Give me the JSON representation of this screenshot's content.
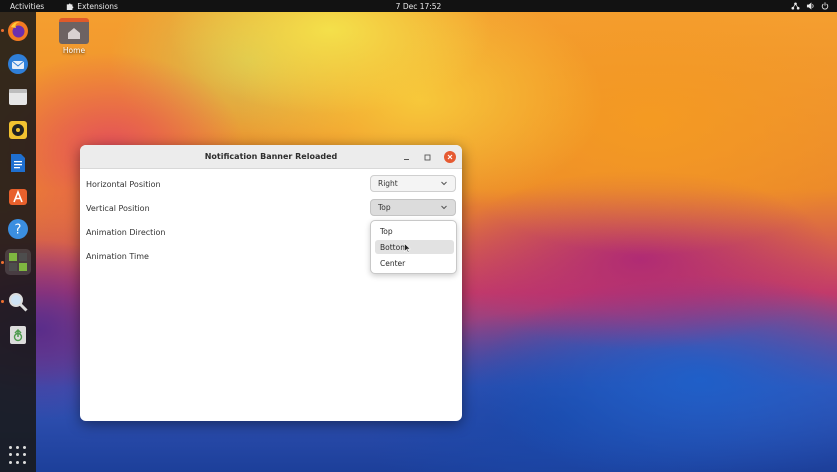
{
  "topbar": {
    "activities": "Activities",
    "extensions": "Extensions",
    "clock": "7 Dec  17:52"
  },
  "desktop": {
    "home_label": "Home"
  },
  "dock": {
    "items": [
      "firefox-icon",
      "thunderbird-icon",
      "files-icon",
      "rhythmbox-icon",
      "writer-icon",
      "software-icon",
      "help-icon",
      "extensions-icon",
      "image-viewer-icon",
      "trash-icon"
    ]
  },
  "window": {
    "title": "Notification Banner Reloaded",
    "rows": [
      {
        "label": "Horizontal Position",
        "value": "Right"
      },
      {
        "label": "Vertical Position",
        "value": "Top"
      },
      {
        "label": "Animation Direction"
      },
      {
        "label": "Animation Time"
      }
    ]
  },
  "dropdown": {
    "options": [
      "Top",
      "Bottom",
      "Center"
    ],
    "hovered": "Bottom"
  },
  "colors": {
    "close_button": "#e65a32",
    "accent_orange": "#f07030"
  }
}
